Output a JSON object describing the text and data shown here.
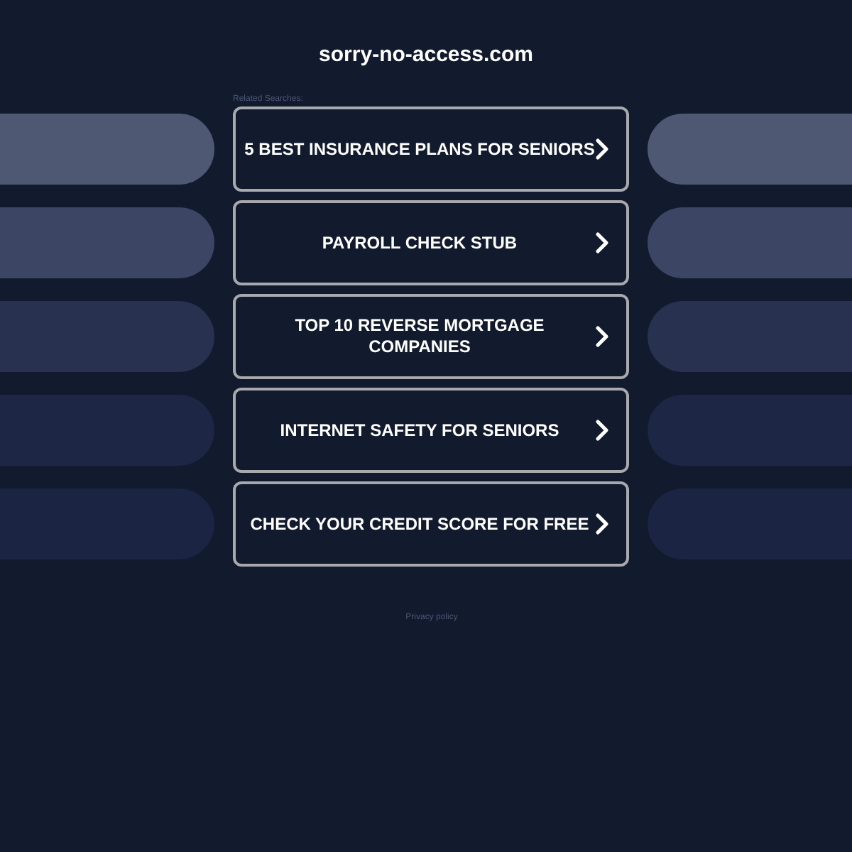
{
  "site_title": "sorry-no-access.com",
  "related_label": "Related Searches:",
  "links": [
    {
      "label": "5 BEST INSURANCE PLANS FOR SENIORS"
    },
    {
      "label": "PAYROLL CHECK STUB"
    },
    {
      "label": "TOP 10 REVERSE MORTGAGE COMPANIES"
    },
    {
      "label": "INTERNET SAFETY FOR SENIORS"
    },
    {
      "label": "CHECK YOUR CREDIT SCORE FOR FREE"
    }
  ],
  "footer": {
    "privacy_link": "Privacy policy"
  }
}
